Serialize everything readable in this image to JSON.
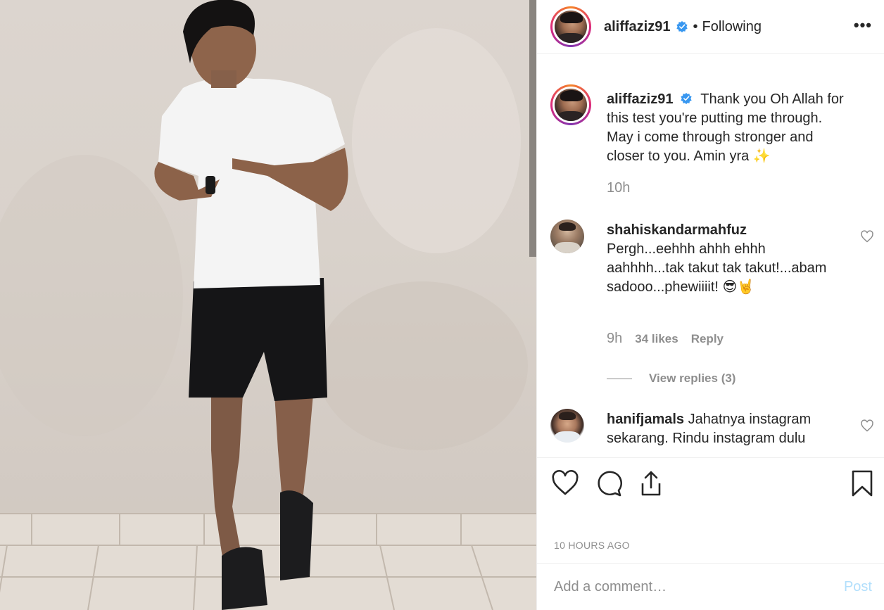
{
  "post": {
    "author": "aliffaziz91",
    "follow_status": "Following",
    "dot": "•",
    "more_label": "•••",
    "caption_text": "Thank you Oh Allah for this test you're putting me through. May i come through stronger and closer to you. Amin yra ✨",
    "caption_time": "10h",
    "time_ago": "10 HOURS AGO"
  },
  "comments": [
    {
      "username": "shahiskandarmahfuz",
      "text": "Pergh...eehhh ahhh ehhh aahhhh...tak takut tak takut!...abam sadooo...phewiiiit! 😎🤘",
      "time": "9h",
      "likes": "34 likes",
      "reply": "Reply",
      "view_replies": "View replies (3)"
    },
    {
      "username": "hanifjamals",
      "text": "Jahatnya instagram sekarang. Rindu instagram dulu"
    }
  ],
  "composer": {
    "placeholder": "Add a comment…",
    "post_label": "Post"
  },
  "icons": [
    "heart-icon",
    "comment-icon",
    "share-icon",
    "bookmark-icon",
    "verified-badge-icon",
    "more-options-icon"
  ],
  "colors": {
    "verified": "#3897f0",
    "post_disabled": "#b2dffc",
    "muted": "#8e8e8e"
  }
}
